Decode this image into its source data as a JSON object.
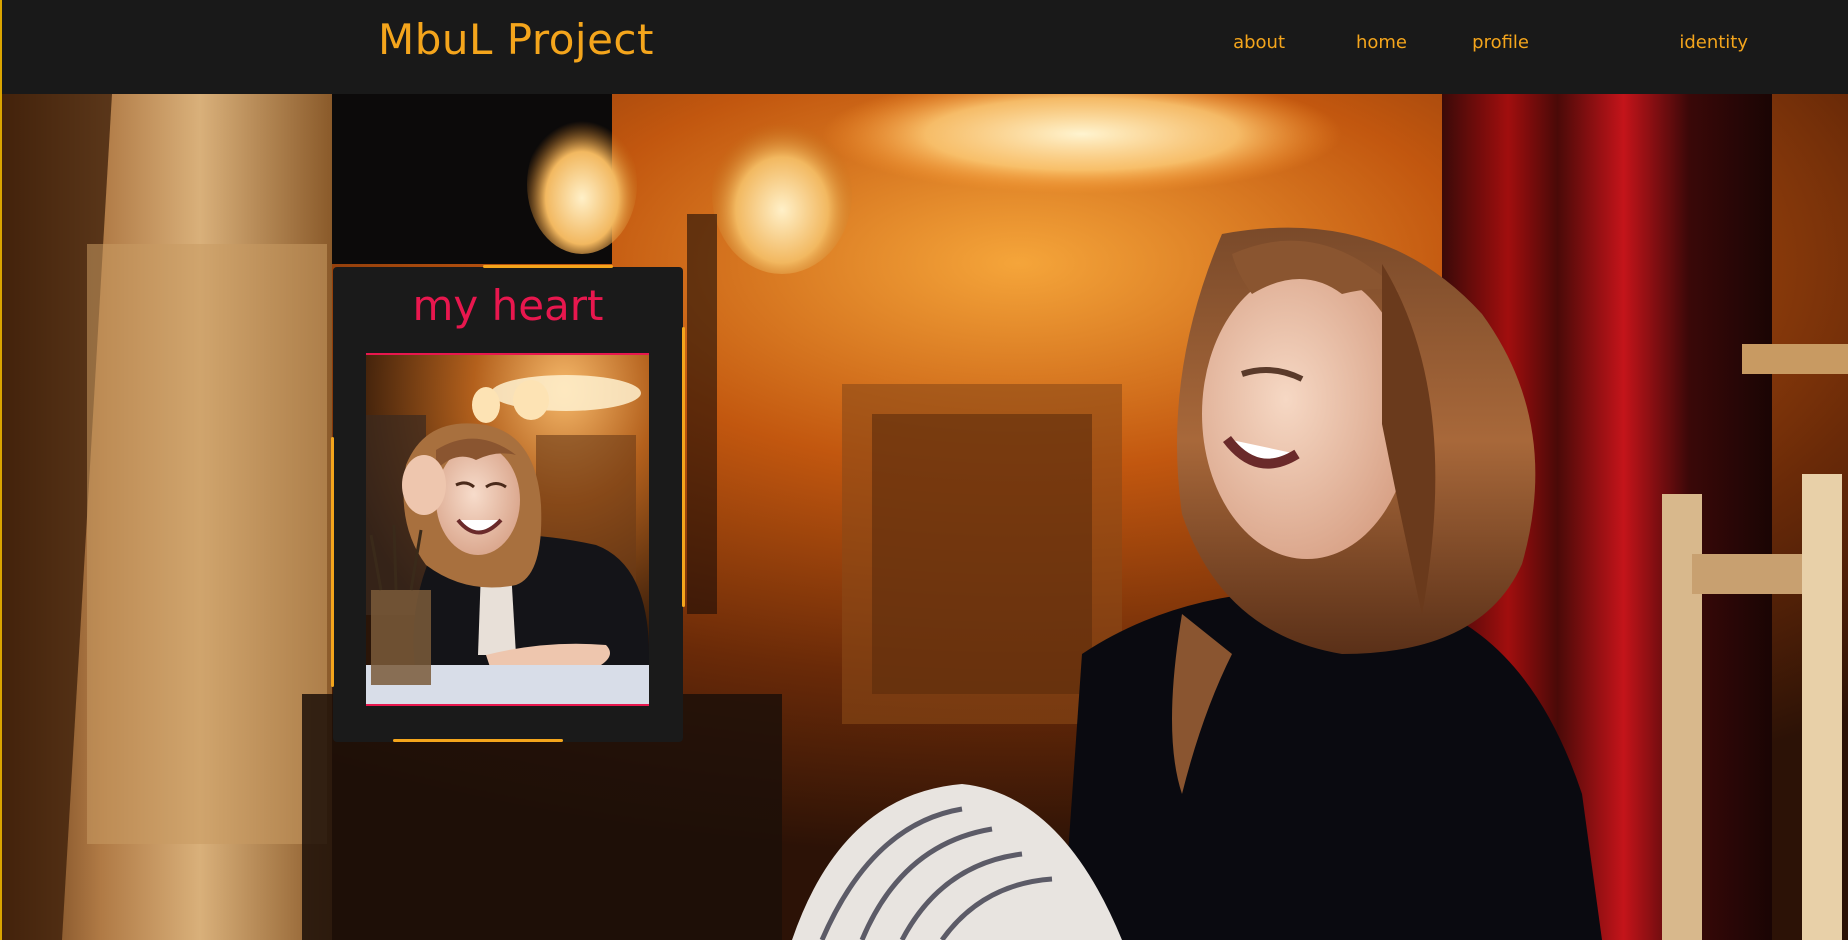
{
  "header": {
    "brand": "MbuL Project",
    "nav": [
      {
        "label": "about"
      },
      {
        "label": "home"
      },
      {
        "label": "profile"
      },
      {
        "label": "identity"
      }
    ]
  },
  "card": {
    "title": "my heart"
  },
  "colors": {
    "header_bg": "#191919",
    "brand_accent": "#f4a51c",
    "card_title": "#e8174e",
    "card_bg": "#1a1a1a"
  }
}
